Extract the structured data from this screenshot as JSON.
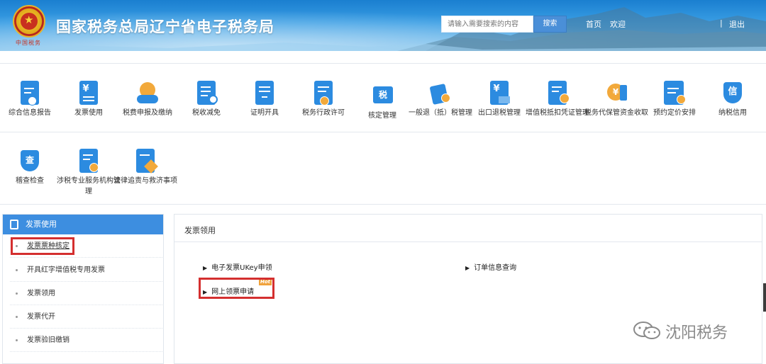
{
  "header": {
    "title": "国家税务总局辽宁省电子税务局",
    "emblem_caption": "中国税务",
    "search_placeholder": "请输入需要搜索的内容",
    "search_button": "搜索",
    "nav_home": "首页",
    "nav_welcome": "欢迎",
    "nav_separator": "|",
    "nav_logout": "退出"
  },
  "grid": {
    "row1": [
      {
        "label": "综合信息报告",
        "icon": "info-report-icon"
      },
      {
        "label": "发票使用",
        "icon": "invoice-icon"
      },
      {
        "label": "税费申报及缴纳",
        "icon": "declare-pay-icon"
      },
      {
        "label": "税收减免",
        "icon": "tax-relief-icon"
      },
      {
        "label": "证明开具",
        "icon": "certificate-icon"
      },
      {
        "label": "税务行政许可",
        "icon": "admin-license-icon"
      },
      {
        "label": "核定管理",
        "icon": "assessment-icon"
      },
      {
        "label": "一般退（抵）税管理",
        "icon": "refund-icon"
      },
      {
        "label": "出口退税管理",
        "icon": "export-refund-icon"
      },
      {
        "label": "增值税抵扣凭证管理",
        "icon": "vat-deduction-icon"
      },
      {
        "label": "税务代保管资金收取",
        "icon": "custody-funds-icon"
      },
      {
        "label": "预约定价安排",
        "icon": "pricing-icon"
      },
      {
        "label": "纳税信用",
        "icon": "tax-credit-icon"
      }
    ],
    "row2": [
      {
        "label": "稽查检查",
        "icon": "inspection-icon"
      },
      {
        "label": "涉税专业服务机构管理",
        "icon": "agency-icon"
      },
      {
        "label": "法律追责与救济事项",
        "icon": "legal-icon"
      }
    ]
  },
  "sidebar": {
    "title": "发票使用",
    "items": [
      {
        "label": "发票票种核定"
      },
      {
        "label": "开具红字增值税专用发票"
      },
      {
        "label": "发票领用"
      },
      {
        "label": "发票代开"
      },
      {
        "label": "发票验旧缴销"
      }
    ]
  },
  "main": {
    "title": "发票领用",
    "links": [
      {
        "label": "电子发票UKey申领"
      },
      {
        "label": "订单信息查询"
      },
      {
        "label": "网上领票申请"
      }
    ],
    "hot_tag": "Hot"
  },
  "watermark": {
    "text": "沈阳税务"
  },
  "colors": {
    "accent": "#3d8ee0",
    "highlight": "#d42f2f",
    "hot": "#f0a23b"
  }
}
